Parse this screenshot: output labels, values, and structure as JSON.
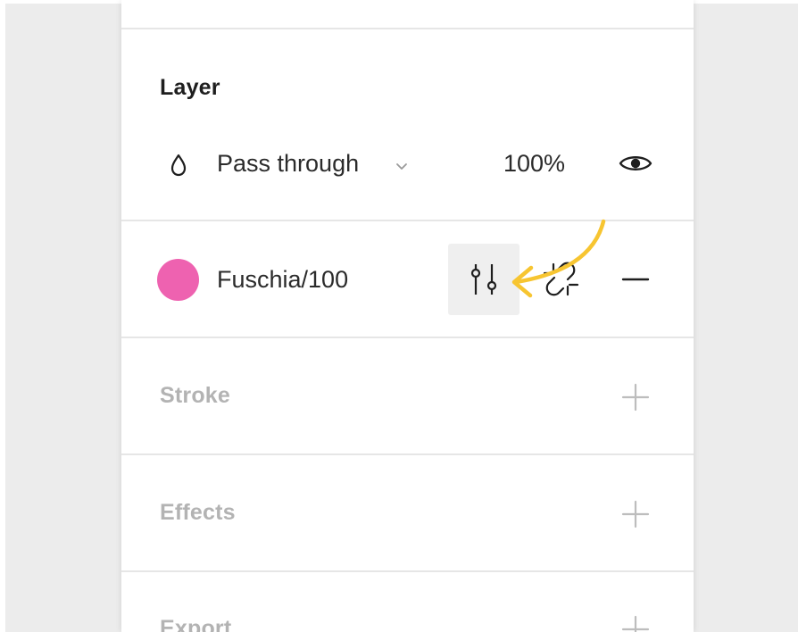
{
  "layer": {
    "title": "Layer",
    "blend_mode": "Pass through",
    "opacity": "100%"
  },
  "fill": {
    "color_name": "Fuschia/100",
    "swatch_color": "#ee62b0"
  },
  "stroke": {
    "title": "Stroke"
  },
  "effects": {
    "title": "Effects"
  },
  "export": {
    "title": "Export"
  },
  "icons": {
    "blend": "drop-icon",
    "dropdown": "chevron-down-icon",
    "visibility": "eye-icon",
    "style": "sliders-icon",
    "detach": "unlink-icon",
    "remove": "minus-icon",
    "add": "plus-icon"
  },
  "annotation_color": "#f7c531"
}
